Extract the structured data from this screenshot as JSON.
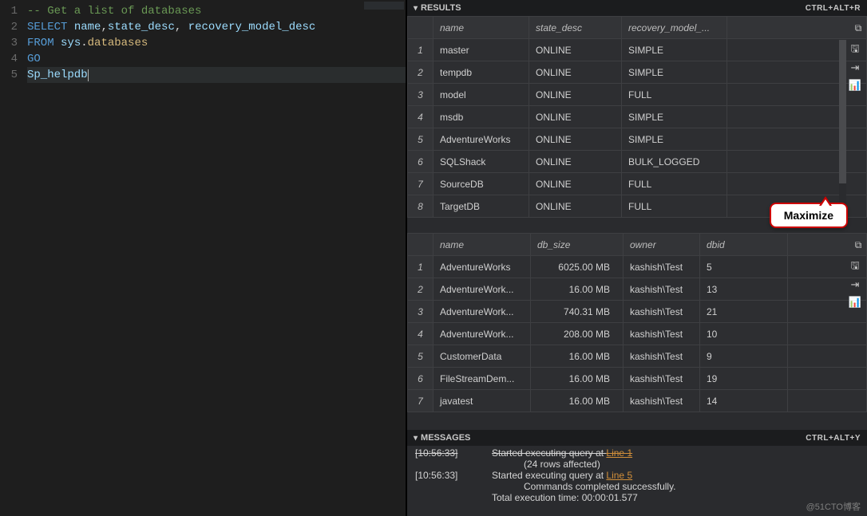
{
  "editor": {
    "lines": [
      {
        "n": "1",
        "tokens": [
          [
            "comment",
            "-- Get a list of databases"
          ]
        ]
      },
      {
        "n": "2",
        "tokens": [
          [
            "keyword",
            "SELECT"
          ],
          [
            "punc",
            " "
          ],
          [
            "ident",
            "name"
          ],
          [
            "punc",
            ","
          ],
          [
            "ident",
            "state_desc"
          ],
          [
            "punc",
            ", "
          ],
          [
            "ident",
            "recovery_model_desc"
          ]
        ]
      },
      {
        "n": "3",
        "tokens": [
          [
            "keyword",
            "FROM"
          ],
          [
            "punc",
            " "
          ],
          [
            "ident",
            "sys"
          ],
          [
            "punc",
            "."
          ],
          [
            "member",
            "databases"
          ]
        ]
      },
      {
        "n": "4",
        "tokens": [
          [
            "keyword",
            "GO"
          ]
        ]
      },
      {
        "n": "5",
        "tokens": [
          [
            "ident",
            "Sp_helpdb"
          ]
        ],
        "active": true
      }
    ]
  },
  "panels": {
    "results_title": "RESULTS",
    "results_shortcut": "CTRL+ALT+R",
    "messages_title": "MESSAGES",
    "messages_shortcut": "CTRL+ALT+Y"
  },
  "results1": {
    "headers": [
      "name",
      "state_desc",
      "recovery_model_..."
    ],
    "rows": [
      {
        "n": "1",
        "name": "master",
        "state": "ONLINE",
        "rec": "SIMPLE"
      },
      {
        "n": "2",
        "name": "tempdb",
        "state": "ONLINE",
        "rec": "SIMPLE"
      },
      {
        "n": "3",
        "name": "model",
        "state": "ONLINE",
        "rec": "FULL"
      },
      {
        "n": "4",
        "name": "msdb",
        "state": "ONLINE",
        "rec": "SIMPLE"
      },
      {
        "n": "5",
        "name": "AdventureWorks",
        "state": "ONLINE",
        "rec": "SIMPLE"
      },
      {
        "n": "6",
        "name": "SQLShack",
        "state": "ONLINE",
        "rec": "BULK_LOGGED"
      },
      {
        "n": "7",
        "name": "SourceDB",
        "state": "ONLINE",
        "rec": "FULL"
      },
      {
        "n": "8",
        "name": "TargetDB",
        "state": "ONLINE",
        "rec": "FULL"
      }
    ]
  },
  "results2": {
    "headers": [
      "name",
      "db_size",
      "owner",
      "dbid"
    ],
    "rows": [
      {
        "n": "1",
        "name": "AdventureWorks",
        "size": "6025.00 MB",
        "owner": "kashish\\Test",
        "dbid": "5"
      },
      {
        "n": "2",
        "name": "AdventureWork...",
        "size": "16.00 MB",
        "owner": "kashish\\Test",
        "dbid": "13"
      },
      {
        "n": "3",
        "name": "AdventureWork...",
        "size": "740.31 MB",
        "owner": "kashish\\Test",
        "dbid": "21"
      },
      {
        "n": "4",
        "name": "AdventureWork...",
        "size": "208.00 MB",
        "owner": "kashish\\Test",
        "dbid": "10"
      },
      {
        "n": "5",
        "name": "CustomerData",
        "size": "16.00 MB",
        "owner": "kashish\\Test",
        "dbid": "9"
      },
      {
        "n": "6",
        "name": "FileStreamDem...",
        "size": "16.00 MB",
        "owner": "kashish\\Test",
        "dbid": "19"
      },
      {
        "n": "7",
        "name": "javatest",
        "size": "16.00 MB",
        "owner": "kashish\\Test",
        "dbid": "14"
      }
    ]
  },
  "callout": {
    "text": "Maximize"
  },
  "messages": {
    "lines": [
      {
        "ts": "[10:56:33]",
        "txt_prefix": "Started executing query at ",
        "link": "Line 1",
        "strike": true
      },
      {
        "ts": "",
        "txt": "(24 rows affected)",
        "indent": true
      },
      {
        "ts": "[10:56:33]",
        "txt_prefix": "Started executing query at ",
        "link": "Line 5"
      },
      {
        "ts": "",
        "txt": "Commands completed successfully.",
        "indent": true
      },
      {
        "ts": "",
        "txt": "Total execution time: 00:00:01.577"
      }
    ]
  },
  "watermark": "@51CTO博客",
  "icons": {
    "maximize": "⧉",
    "save_csv": "🖫",
    "save_json": "⇥",
    "chart": "📊",
    "expand": "⤢"
  }
}
